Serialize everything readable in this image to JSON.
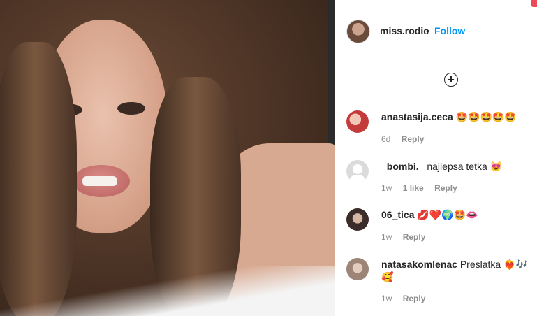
{
  "post": {
    "username": "miss.rodic",
    "separator": "•",
    "follow_label": "Follow"
  },
  "comments": [
    {
      "username": "anastasija.ceca",
      "text": "🤩🤩🤩🤩🤩",
      "time": "6d",
      "likes": "",
      "reply": "Reply"
    },
    {
      "username": "_bombi._",
      "text": "najlepsa tetka 😻",
      "time": "1w",
      "likes": "1 like",
      "reply": "Reply"
    },
    {
      "username": "06_tica",
      "text": "💋❤️🌍🤩👄",
      "time": "1w",
      "likes": "",
      "reply": "Reply"
    },
    {
      "username": "natasakomlenac",
      "text": "Preslatka ❤️‍🔥🎶🥰",
      "time": "1w",
      "likes": "",
      "reply": "Reply"
    }
  ],
  "icons": {
    "add_comments": "plus-circle-icon"
  },
  "colors": {
    "follow": "#0095f6",
    "text": "#262626",
    "meta": "#8e8e8e"
  }
}
